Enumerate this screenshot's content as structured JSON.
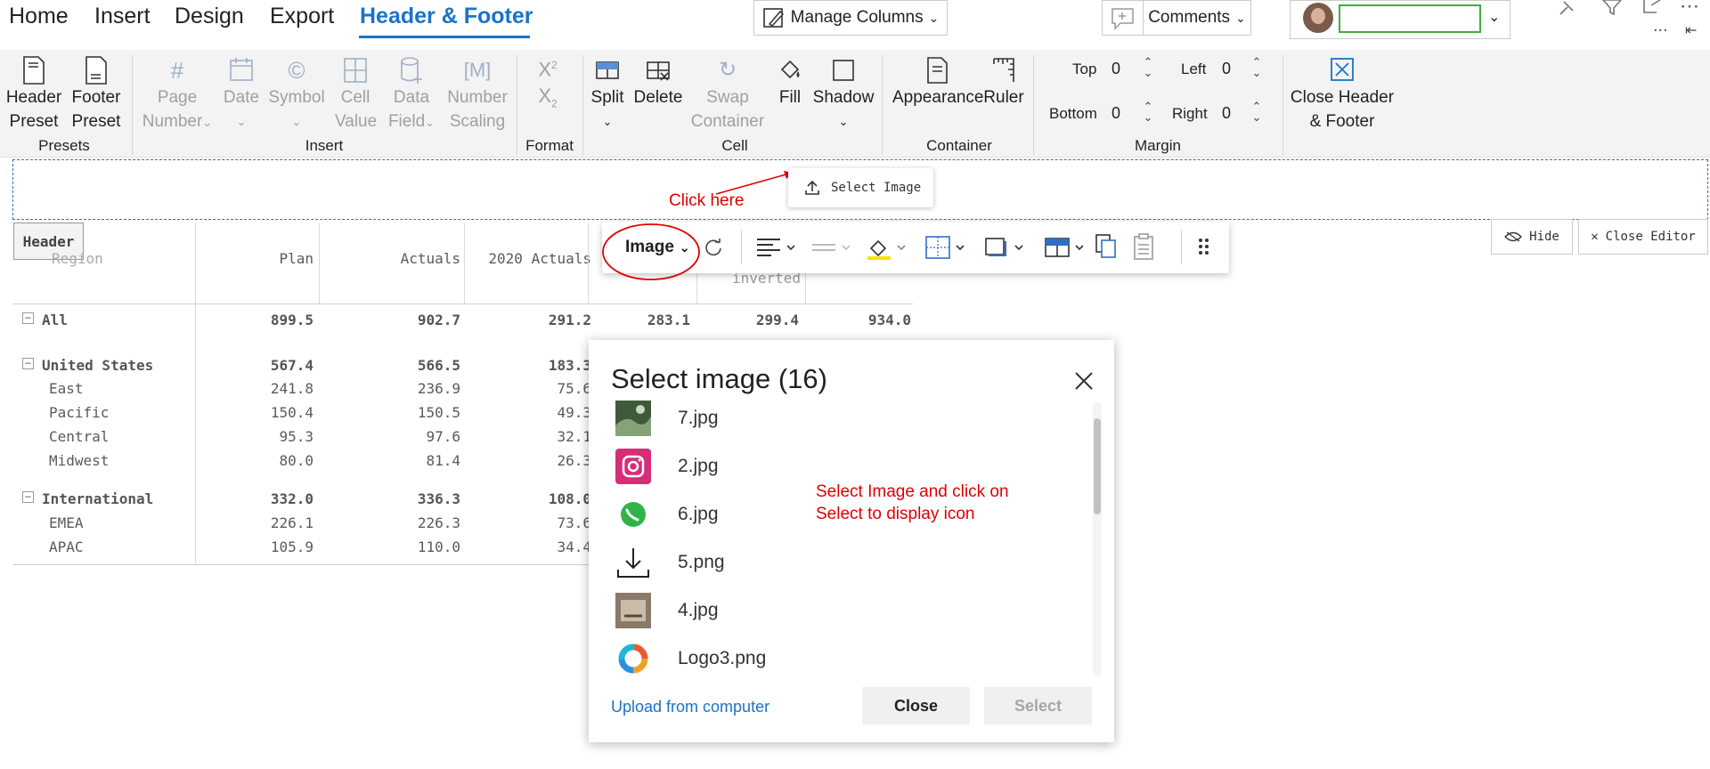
{
  "menu": {
    "tabs": [
      "Home",
      "Insert",
      "Design",
      "Export",
      "Header & Footer"
    ],
    "active_tab": "Header & Footer"
  },
  "topbar": {
    "manage_columns_label": "Manage Columns",
    "comments_label": "Comments",
    "user_input_value": "",
    "more_label": "..."
  },
  "ribbon": {
    "presets": {
      "header_preset": [
        "Header",
        "Preset"
      ],
      "footer_preset": [
        "Footer",
        "Preset"
      ],
      "group_label": "Presets"
    },
    "insert": {
      "page_number": [
        "Page",
        "Number"
      ],
      "date": "Date",
      "symbol": "Symbol",
      "cell_value": [
        "Cell",
        "Value"
      ],
      "data_field": [
        "Data",
        "Field"
      ],
      "number_scaling": [
        "Number",
        "Scaling"
      ],
      "group_label": "Insert"
    },
    "format": {
      "superscript": "X",
      "superscript_mark": "2",
      "subscript": "X",
      "subscript_mark": "2",
      "group_label": "Format"
    },
    "cell": {
      "split": "Split",
      "delete": "Delete",
      "swap": [
        "Swap",
        "Container"
      ],
      "fill": "Fill",
      "shadow": "Shadow",
      "group_label": "Cell"
    },
    "container": {
      "appearance": "Appearance",
      "ruler": "Ruler",
      "group_label": "Container"
    },
    "margin": {
      "top_label": "Top",
      "top_value": "0",
      "left_label": "Left",
      "left_value": "0",
      "bottom_label": "Bottom",
      "bottom_value": "0",
      "right_label": "Right",
      "right_value": "0",
      "group_label": "Margin"
    },
    "close": [
      "Close Header",
      "& Footer"
    ]
  },
  "annotations": {
    "click_here": "Click here",
    "select_hint": [
      "Select Image and click on",
      "Select to display icon"
    ]
  },
  "select_image_popup": {
    "label": "Select Image"
  },
  "header_tag": "Header",
  "table": {
    "columns": [
      "Region",
      "Plan",
      "Actuals",
      "2020 Actuals"
    ],
    "inverted_label": "inverted",
    "rows": [
      {
        "label": "All",
        "bold": true,
        "expander": true,
        "values": [
          "899.5",
          "902.7",
          "291.2",
          "283.1",
          "299.4",
          "934.0"
        ]
      },
      {
        "label": "United States",
        "bold": true,
        "expander": true,
        "values": [
          "567.4",
          "566.5",
          "183.3"
        ]
      },
      {
        "label": "East",
        "bold": false,
        "expander": false,
        "values": [
          "241.8",
          "236.9",
          "75.6"
        ]
      },
      {
        "label": "Pacific",
        "bold": false,
        "expander": false,
        "values": [
          "150.4",
          "150.5",
          "49.3"
        ]
      },
      {
        "label": "Central",
        "bold": false,
        "expander": false,
        "values": [
          "95.3",
          "97.6",
          "32.1"
        ]
      },
      {
        "label": "Midwest",
        "bold": false,
        "expander": false,
        "values": [
          "80.0",
          "81.4",
          "26.3"
        ]
      },
      {
        "label": "International",
        "bold": true,
        "expander": true,
        "values": [
          "332.0",
          "336.3",
          "108.0"
        ]
      },
      {
        "label": "EMEA",
        "bold": false,
        "expander": false,
        "values": [
          "226.1",
          "226.3",
          "73.6"
        ]
      },
      {
        "label": "APAC",
        "bold": false,
        "expander": false,
        "values": [
          "105.9",
          "110.0",
          "34.4"
        ]
      }
    ]
  },
  "float_toolbar": {
    "image_label": "Image"
  },
  "side_buttons": {
    "hide": "Hide",
    "close_editor": "Close Editor"
  },
  "dialog": {
    "title": "Select image (16)",
    "images": [
      "7.jpg",
      "2.jpg",
      "6.jpg",
      "5.png",
      "4.jpg",
      "Logo3.png"
    ],
    "upload_link": "Upload from computer",
    "close_button": "Close",
    "select_button": "Select"
  },
  "colors": {
    "accent": "#1a73c8",
    "annotation": "#e00000",
    "header_border": "#2f6fc4"
  }
}
